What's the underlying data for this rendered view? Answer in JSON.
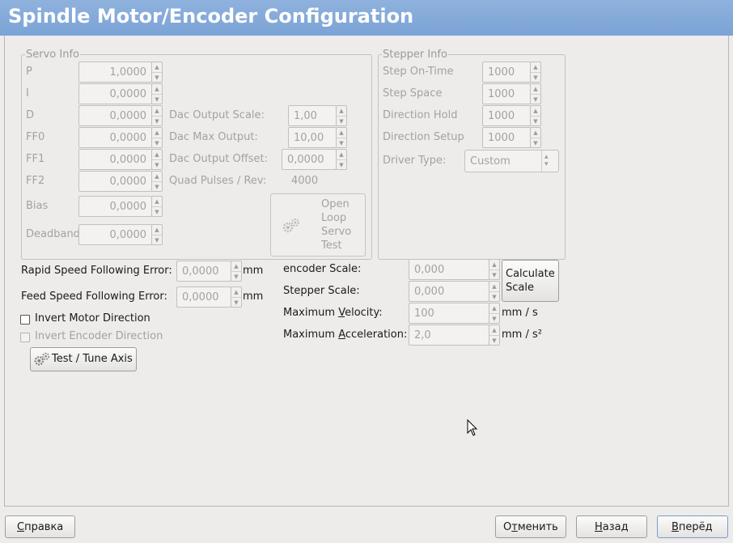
{
  "window": {
    "title": "Spindle Motor/Encoder Configuration"
  },
  "servo": {
    "group_label": "Servo Info",
    "p_label": "P",
    "p_value": "1,0000",
    "i_label": "I",
    "i_value": "0,0000",
    "d_label": "D",
    "d_value": "0,0000",
    "ff0_label": "FF0",
    "ff0_value": "0,0000",
    "ff1_label": "FF1",
    "ff1_value": "0,0000",
    "ff2_label": "FF2",
    "ff2_value": "0,0000",
    "bias_label": "Bias",
    "bias_value": "0,0000",
    "deadband_label": "Deadband",
    "deadband_value": "0,0000",
    "dac_scale_label": "Dac Output Scale:",
    "dac_scale_value": "1,00",
    "dac_max_label": "Dac Max Output:",
    "dac_max_value": "10,00",
    "dac_offset_label": "Dac Output Offset:",
    "dac_offset_value": "0,0000",
    "quad_label": "Quad Pulses / Rev:",
    "quad_value": "4000",
    "open_loop_line1": "Open",
    "open_loop_line2": "Loop",
    "open_loop_line3": "Servo",
    "open_loop_line4": "Test"
  },
  "stepper": {
    "group_label": "Stepper Info",
    "on_time_label": "Step On-Time",
    "on_time_value": "1000",
    "space_label": "Step Space",
    "space_value": "1000",
    "dir_hold_label": "Direction Hold",
    "dir_hold_value": "1000",
    "dir_setup_label": "Direction Setup",
    "dir_setup_value": "1000",
    "driver_label": "Driver Type:",
    "driver_value": "Custom"
  },
  "following": {
    "rapid_label": "Rapid Speed Following Error:",
    "rapid_value": "0,0000",
    "rapid_unit": "mm",
    "feed_label": "Feed Speed Following Error:",
    "feed_value": "0,0000",
    "feed_unit": "mm"
  },
  "scale": {
    "encoder_label": "encoder Scale:",
    "encoder_value": "0,000",
    "stepper_label": "Stepper Scale:",
    "stepper_value": "0,000",
    "calc_line1": "Calculate",
    "calc_line2": "Scale",
    "velocity_label_pre": "Maximum ",
    "velocity_label_key": "V",
    "velocity_label_post": "elocity:",
    "velocity_value": "100",
    "velocity_unit": "mm / s",
    "accel_label_pre": "Maximum ",
    "accel_label_key": "A",
    "accel_label_post": "cceleration:",
    "accel_value": "2,0",
    "accel_unit": "mm / s²"
  },
  "options": {
    "invert_motor": "Invert Motor Direction",
    "invert_motor_checked": false,
    "invert_encoder": "Invert Encoder Direction",
    "invert_encoder_checked": false,
    "test_tune": "Test / Tune Axis"
  },
  "footer": {
    "help_key": "С",
    "help_rest": "правка",
    "cancel_pre": "О",
    "cancel_key": "т",
    "cancel_post": "менить",
    "back_key": "Н",
    "back_rest": "азад",
    "forward_key": "В",
    "forward_rest": "перёд"
  },
  "icons": {
    "gear": "gears-icon",
    "cursor": "mouse-cursor-icon"
  }
}
